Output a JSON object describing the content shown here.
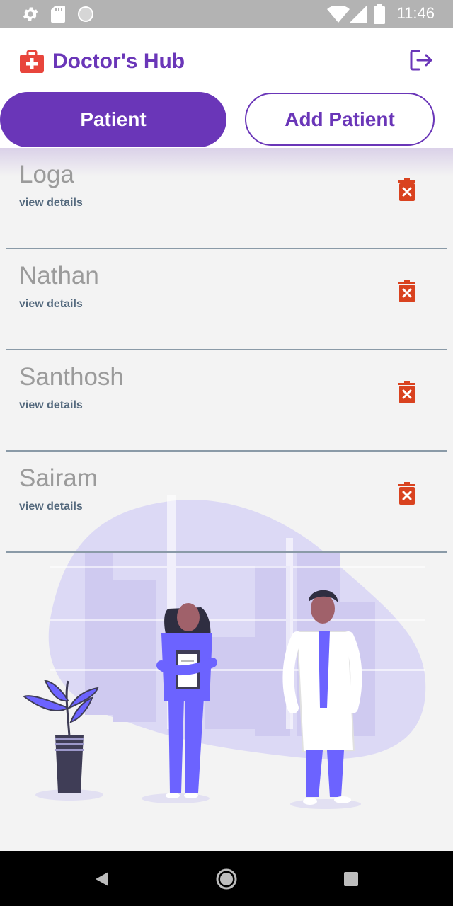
{
  "status_bar": {
    "time": "11:46",
    "icons": [
      "settings-icon",
      "sd-card-icon",
      "circle-icon",
      "wifi-icon",
      "signal-icon",
      "battery-icon"
    ]
  },
  "header": {
    "title": "Doctor's Hub",
    "logo_icon": "medical-kit-icon",
    "logout_icon": "logout-icon"
  },
  "tabs": {
    "patient_label": "Patient",
    "add_patient_label": "Add Patient"
  },
  "patients": [
    {
      "name": "Loga",
      "link": "view details"
    },
    {
      "name": "Nathan",
      "link": "view details"
    },
    {
      "name": "Santhosh",
      "link": "view details"
    },
    {
      "name": "Sairam",
      "link": "view details"
    }
  ],
  "colors": {
    "accent": "#6a36b8",
    "delete": "#d9421f",
    "status_bar": "#b3b3b3",
    "background": "#f3f3f3"
  },
  "nav_bar": {
    "icons": [
      "back-icon",
      "home-icon",
      "recents-icon"
    ]
  }
}
